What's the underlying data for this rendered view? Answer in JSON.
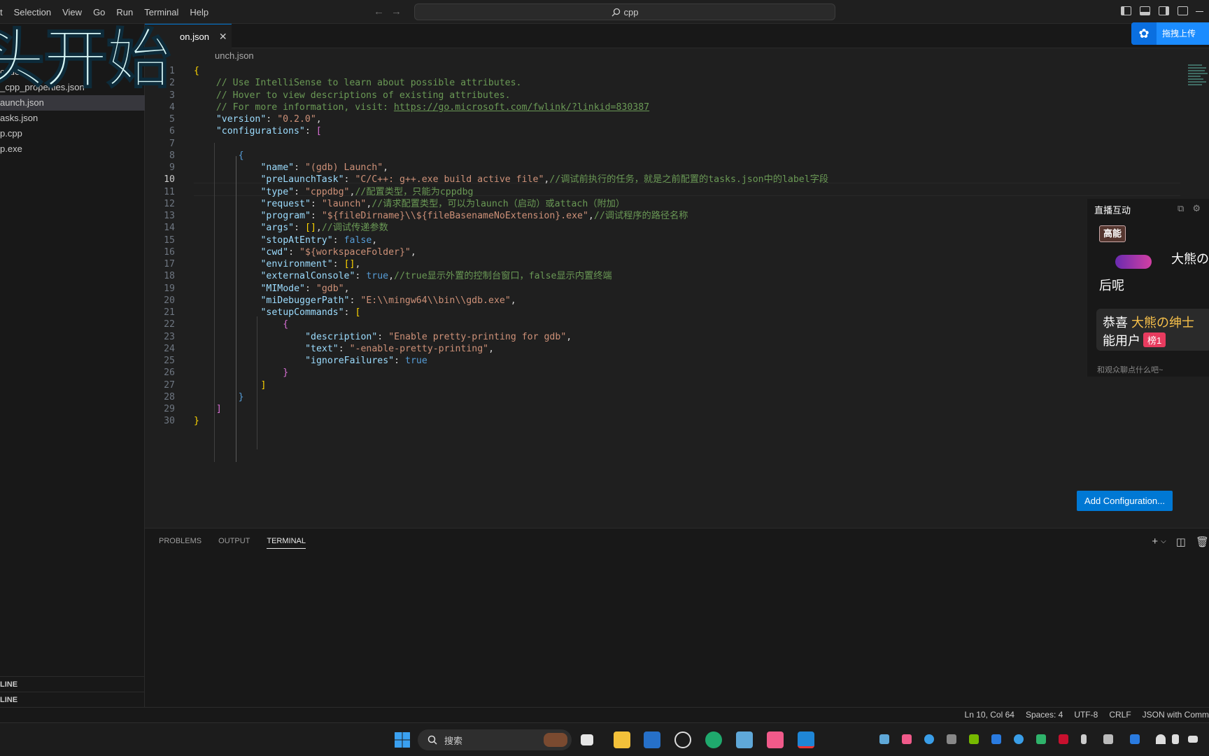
{
  "menu": [
    "t",
    "Selection",
    "View",
    "Go",
    "Run",
    "Terminal",
    "Help"
  ],
  "command_center": {
    "text": "cpp"
  },
  "sidebar": {
    "items": [
      {
        "label": "code"
      },
      {
        "label": "_cpp_properties.json"
      },
      {
        "label": "aunch.json",
        "selected": true
      },
      {
        "label": "asks.json"
      },
      {
        "label": "p.cpp"
      },
      {
        "label": "p.exe"
      }
    ],
    "outline_label": "LINE",
    "timeline_label": "LINE"
  },
  "tab": {
    "label": "on.json"
  },
  "breadcrumb": "unch.json",
  "editor": {
    "current_line": 10,
    "lines": [
      "{",
      "    // Use IntelliSense to learn about possible attributes.",
      "    // Hover to view descriptions of existing attributes.",
      "    // For more information, visit: https://go.microsoft.com/fwlink/?linkid=830387",
      "    \"version\": \"0.2.0\",",
      "    \"configurations\": [",
      "",
      "        {",
      "            \"name\": \"(gdb) Launch\",",
      "            \"preLaunchTask\": \"C/C++: g++.exe build active file\",//调试前执行的任务，就是之前配置的tasks.json中的label字段",
      "            \"type\": \"cppdbg\",//配置类型，只能为cppdbg",
      "            \"request\": \"launch\",//请求配置类型，可以为launch（启动）或attach（附加）",
      "            \"program\": \"${fileDirname}\\\\${fileBasenameNoExtension}.exe\",//调试程序的路径名称",
      "            \"args\": [],//调试传递参数",
      "            \"stopAtEntry\": false,",
      "            \"cwd\": \"${workspaceFolder}\",",
      "            \"environment\": [],",
      "            \"externalConsole\": true,//true显示外置的控制台窗口，false显示内置终端",
      "            \"MIMode\": \"gdb\",",
      "            \"miDebuggerPath\": \"E:\\\\mingw64\\\\bin\\\\gdb.exe\",",
      "            \"setupCommands\": [",
      "                {",
      "                    \"description\": \"Enable pretty-printing for gdb\",",
      "                    \"text\": \"-enable-pretty-printing\",",
      "                    \"ignoreFailures\": true",
      "                }",
      "            ]",
      "        }",
      "    ]",
      "}"
    ]
  },
  "add_configuration_label": "Add Configuration...",
  "panel": {
    "tabs": [
      "PROBLEMS",
      "OUTPUT",
      "TERMINAL"
    ],
    "active_tab": "TERMINAL"
  },
  "statusbar": {
    "position": "Ln 10, Col 64",
    "spaces": "Spaces: 4",
    "encoding": "UTF-8",
    "eol": "CRLF",
    "language": "JSON with Comm"
  },
  "overlay": {
    "title_text": "头开始",
    "upload_label": "拖拽上传"
  },
  "live_panel": {
    "title": "直播互动",
    "badge": "高能",
    "user_name": "大熊の",
    "message": "后呢",
    "congrats_prefix": "恭喜 ",
    "congrats_name": "大熊の绅士",
    "congrats_line2": "能用户",
    "rank_badge": "榜1",
    "input_placeholder": "和观众聊点什么吧~"
  },
  "taskbar": {
    "search_label": "搜索"
  },
  "colors": {
    "accent": "#0078d4",
    "editor_bg": "#1f1f1f",
    "sidebar_bg": "#181818",
    "string": "#ce9178",
    "key": "#9cdcfe",
    "comment": "#6a9955",
    "keyword": "#569cd6"
  }
}
